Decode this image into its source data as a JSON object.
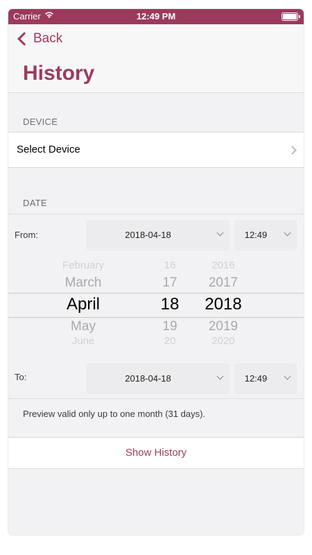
{
  "status_bar": {
    "carrier": "Carrier",
    "time": "12:49 PM"
  },
  "nav": {
    "back_label": "Back",
    "title": "History"
  },
  "device_section": {
    "header": "DEVICE",
    "select_label": "Select Device"
  },
  "date_section": {
    "header": "DATE",
    "from": {
      "label": "From:",
      "date": "2018-04-18",
      "time": "12:49"
    },
    "to": {
      "label": "To:",
      "date": "2018-04-18",
      "time": "12:49"
    }
  },
  "picker": {
    "months": [
      "February",
      "March",
      "April",
      "May",
      "June"
    ],
    "days": [
      "16",
      "17",
      "18",
      "19",
      "20"
    ],
    "years": [
      "2016",
      "2017",
      "2018",
      "2019",
      "2020"
    ]
  },
  "note": "Preview valid only up to one month (31 days).",
  "show_history_label": "Show History",
  "colors": {
    "accent": "#9b3a5e",
    "background": "#f2f2f4"
  }
}
